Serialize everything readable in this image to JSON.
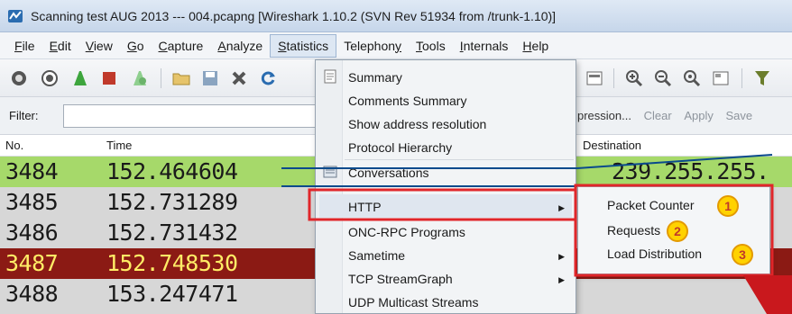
{
  "window": {
    "title": "Scanning test AUG 2013 --- 004.pcapng   [Wireshark 1.10.2  (SVN Rev 51934 from /trunk-1.10)]"
  },
  "menubar": {
    "items": [
      "File",
      "Edit",
      "View",
      "Go",
      "Capture",
      "Analyze",
      "Statistics",
      "Telephony",
      "Tools",
      "Internals",
      "Help"
    ],
    "active": "Statistics"
  },
  "filterbar": {
    "label": "Filter:",
    "value": "",
    "expression_label": "pression...",
    "clear_label": "Clear",
    "apply_label": "Apply",
    "save_label": "Save"
  },
  "packet_list": {
    "columns": {
      "no": "No.",
      "time": "Time",
      "destination": "Destination"
    },
    "rows": [
      {
        "no": "3484",
        "time": "152.464604",
        "destination": "239.255.255.",
        "bg": "#a6d96a",
        "fg": "#1a1a1a"
      },
      {
        "no": "3485",
        "time": "152.731289",
        "destination": "",
        "bg": "#d7d7d7",
        "fg": "#1a1a1a"
      },
      {
        "no": "3486",
        "time": "152.731432",
        "destination": "",
        "bg": "#d7d7d7",
        "fg": "#1a1a1a"
      },
      {
        "no": "3487",
        "time": "152.748530",
        "destination": "",
        "bg": "#8b1a14",
        "fg": "#ffec66"
      },
      {
        "no": "3488",
        "time": "153.247471",
        "destination": "",
        "bg": "#d7d7d7",
        "fg": "#1a1a1a"
      }
    ]
  },
  "statistics_menu": {
    "items": [
      {
        "label": "Summary",
        "icon": "summary-icon"
      },
      {
        "label": "Comments Summary"
      },
      {
        "label": "Show address resolution"
      },
      {
        "label": "Protocol Hierarchy"
      },
      {
        "label": "Conversations",
        "icon": "conversations-icon"
      },
      {
        "label": "HTTP",
        "has_submenu": true,
        "highlighted": true
      },
      {
        "label": "ONC-RPC Programs"
      },
      {
        "label": "Sametime",
        "has_submenu": true
      },
      {
        "label": "TCP StreamGraph",
        "has_submenu": true
      },
      {
        "label": "UDP Multicast Streams"
      }
    ]
  },
  "http_submenu": {
    "items": [
      {
        "label": "Packet Counter",
        "badge": "1"
      },
      {
        "label": "Requests",
        "badge": "2"
      },
      {
        "label": "Load Distribution",
        "badge": "3"
      }
    ]
  },
  "colors": {
    "highlight_box": "#e0262a",
    "badge_fill": "#ffd200",
    "badge_text": "#c0392b",
    "callout_line": "#0a4a8c"
  }
}
